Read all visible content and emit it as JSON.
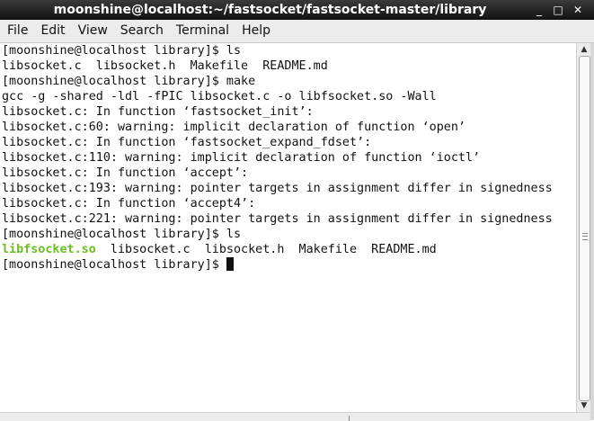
{
  "window": {
    "title": "moonshine@localhost:~/fastsocket/fastsocket-master/library",
    "minimize_icon": "minimize-icon",
    "maximize_icon": "maximize-icon",
    "close_icon": "close-icon",
    "minimize_glyph": "_",
    "maximize_glyph": "□",
    "close_glyph": "✕"
  },
  "menu": {
    "items": [
      "File",
      "Edit",
      "View",
      "Search",
      "Terminal",
      "Help"
    ]
  },
  "terminal": {
    "lines": [
      {
        "text": "[moonshine@localhost library]$ ls"
      },
      {
        "text": "libsocket.c  libsocket.h  Makefile  README.md"
      },
      {
        "text": "[moonshine@localhost library]$ make"
      },
      {
        "text": "gcc -g -shared -ldl -fPIC libsocket.c -o libfsocket.so -Wall"
      },
      {
        "text": "libsocket.c: In function ‘fastsocket_init’:"
      },
      {
        "text": "libsocket.c:60: warning: implicit declaration of function ‘open’"
      },
      {
        "text": "libsocket.c: In function ‘fastsocket_expand_fdset’:"
      },
      {
        "text": "libsocket.c:110: warning: implicit declaration of function ‘ioctl’"
      },
      {
        "text": "libsocket.c: In function ‘accept’:"
      },
      {
        "text": "libsocket.c:193: warning: pointer targets in assignment differ in signedness"
      },
      {
        "text": "libsocket.c: In function ‘accept4’:"
      },
      {
        "text": "libsocket.c:221: warning: pointer targets in assignment differ in signedness"
      },
      {
        "text": "[moonshine@localhost library]$ ls"
      },
      {
        "highlight": "libfsocket.so",
        "text": "  libsocket.c  libsocket.h  Makefile  README.md"
      },
      {
        "text": "[moonshine@localhost library]$ ",
        "cursor": true
      }
    ],
    "highlight_color": "#6bbe22",
    "text_color": "#111111",
    "background": "#ffffff"
  },
  "scrollbar": {
    "up_glyph": "▲",
    "down_glyph": "▼",
    "position": 1.0
  }
}
